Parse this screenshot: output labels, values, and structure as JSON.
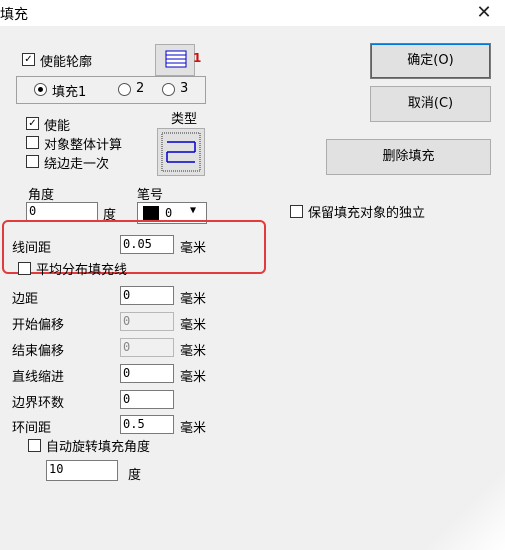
{
  "window": {
    "title": "填充",
    "close_glyph": "✕"
  },
  "left": {
    "enable_contour": {
      "label": "使能轮廓",
      "checked": true
    },
    "fill_tabs": {
      "tab1": "填充1",
      "tab2": "2",
      "tab3": "3",
      "selected": "填充1"
    },
    "enable": {
      "label": "使能",
      "checked": true
    },
    "whole_calc": {
      "label": "对象整体计算",
      "checked": false
    },
    "edge_once": {
      "label": "绕边走一次",
      "checked": false
    },
    "type_label": "类型",
    "pen_icon_badge": "1",
    "angle": {
      "label": "角度",
      "value": "0",
      "unit": "度"
    },
    "pen": {
      "label": "笔号",
      "value": "0"
    },
    "line_spacing": {
      "label": "线间距",
      "value": "0.05",
      "unit": "毫米"
    },
    "even_distribute": {
      "label": "平均分布填充线",
      "checked": false
    },
    "margin": {
      "label": "边距",
      "value": "0",
      "unit": "毫米"
    },
    "start_offset": {
      "label": "开始偏移",
      "value": "0",
      "unit": "毫米"
    },
    "end_offset": {
      "label": "结束偏移",
      "value": "0",
      "unit": "毫米"
    },
    "line_indent": {
      "label": "直线缩进",
      "value": "0",
      "unit": "毫米"
    },
    "loop_count": {
      "label": "边界环数",
      "value": "0"
    },
    "ring_spacing": {
      "label": "环间距",
      "value": "0.5",
      "unit": "毫米"
    },
    "auto_rotate": {
      "label": "自动旋转填充角度",
      "checked": false
    },
    "rotate_angle": {
      "value": "10",
      "unit": "度"
    }
  },
  "right": {
    "ok_label": "确定(O)",
    "cancel_label": "取消(C)",
    "delete_fill_label": "删除填充",
    "keep_independent": {
      "label": "保留填充对象的独立",
      "checked": false
    }
  },
  "colors": {
    "highlight_box": "#e23b3b",
    "accent": "#0000cc"
  }
}
